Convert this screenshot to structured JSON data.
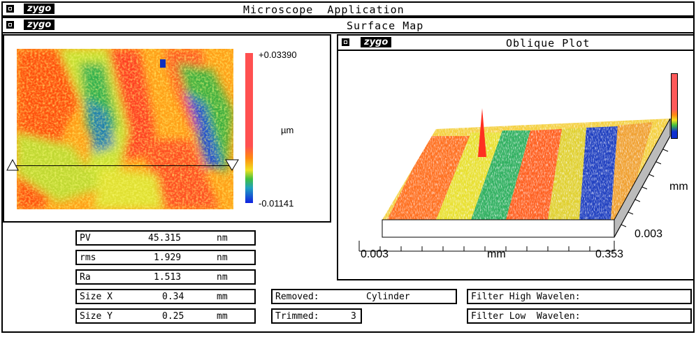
{
  "app": {
    "logo": "zygo",
    "title": "Microscope  Application"
  },
  "surface_window": {
    "logo": "zygo",
    "title": "Surface Map"
  },
  "map_panel": {
    "scale_max": "+0.03390",
    "scale_min": "-0.01141",
    "unit": "µm"
  },
  "oblique": {
    "logo": "zygo",
    "title": "Oblique Plot",
    "x_min": "0.003",
    "x_max": "0.353",
    "x_unit": "mm",
    "y_min": "0.003",
    "y_unit": "mm"
  },
  "stats": [
    {
      "label": "PV",
      "value": "45.315",
      "unit": "nm"
    },
    {
      "label": "rms",
      "value": "1.929",
      "unit": "nm"
    },
    {
      "label": "Ra",
      "value": "1.513",
      "unit": "nm"
    },
    {
      "label": "Size X",
      "value": "0.34",
      "unit": "mm"
    },
    {
      "label": "Size Y",
      "value": "0.25",
      "unit": "mm"
    }
  ],
  "removed": {
    "label": "Removed:",
    "value": "Cylinder"
  },
  "trimmed": {
    "label": "Trimmed:",
    "value": "3"
  },
  "filters": {
    "high": "Filter High Wavelen:",
    "low": "Filter Low  Wavelen:"
  },
  "colors": {
    "red": "#ff3020",
    "orange": "#ff8a10",
    "yellow": "#f0f020",
    "green": "#30c030",
    "cyan": "#20b0b0",
    "blue": "#1030d0"
  }
}
